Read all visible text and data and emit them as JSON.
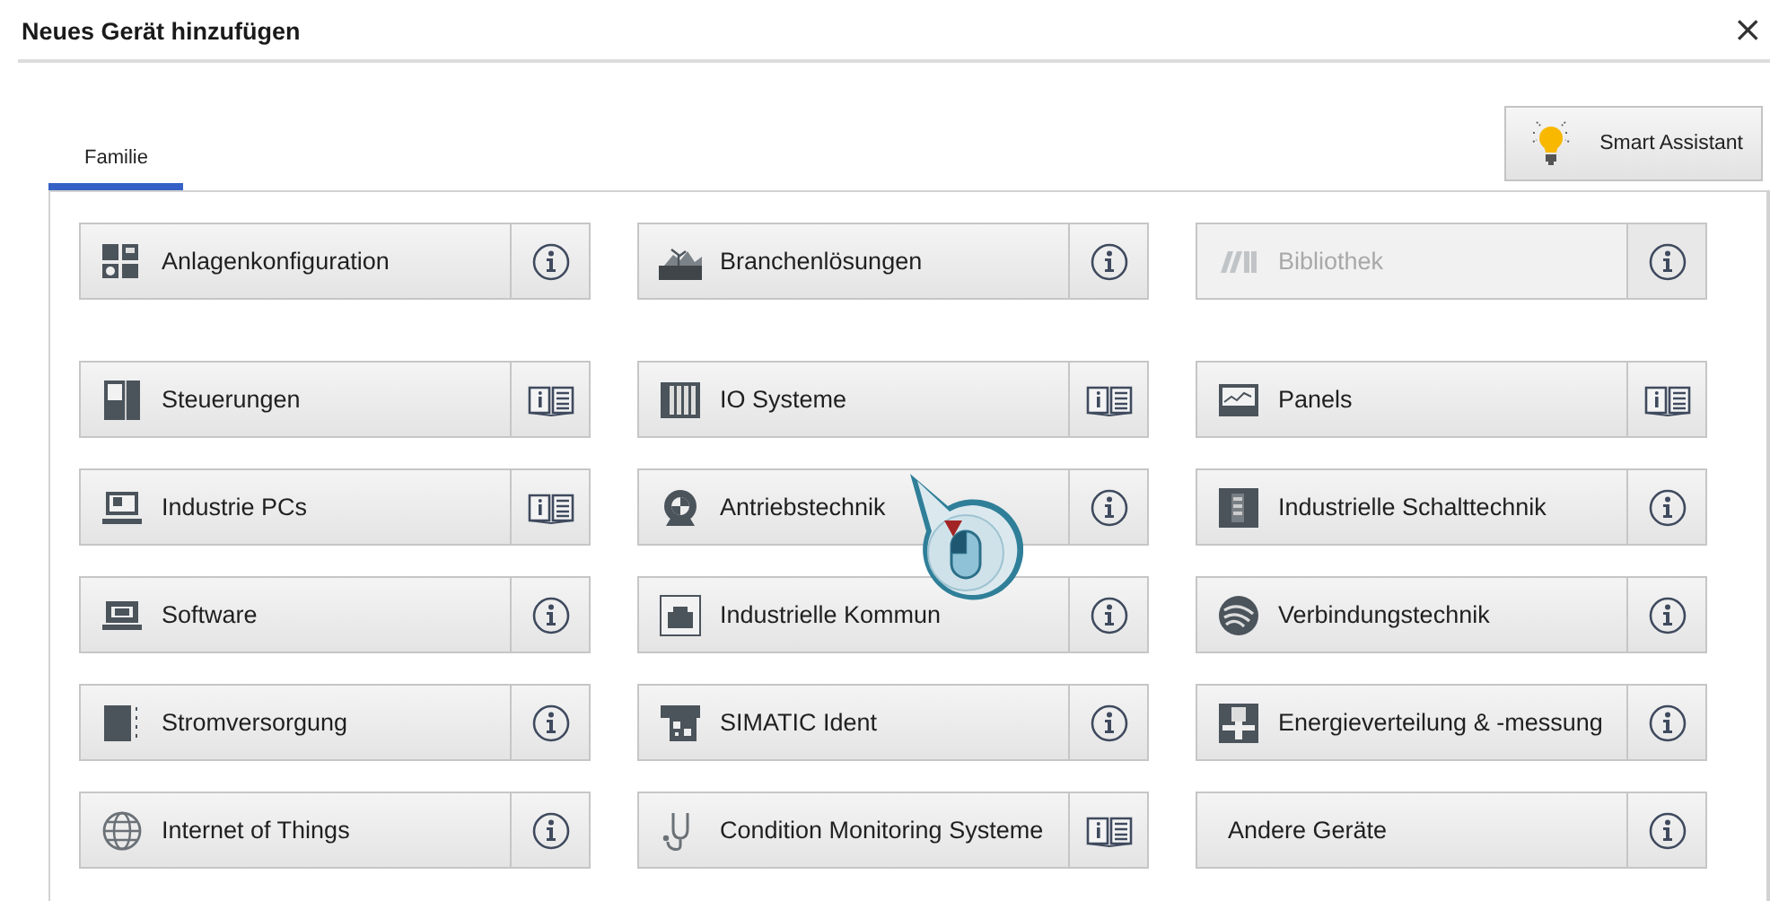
{
  "dialog": {
    "title": "Neues Gerät hinzufügen",
    "close": "×"
  },
  "tabs": [
    {
      "label": "Familie",
      "selected": true
    }
  ],
  "assistant_button": {
    "label": "Smart Assistant"
  },
  "groups": [
    [
      {
        "label": "Anlagenkonfiguration",
        "icon": true,
        "disabled": false,
        "kind": "info"
      },
      {
        "label": "Branchenlösungen",
        "icon": true,
        "disabled": false,
        "kind": "info"
      },
      {
        "label": "Bibliothek",
        "icon": true,
        "disabled": true,
        "kind": "info"
      }
    ],
    [
      {
        "label": "Steuerungen",
        "icon": true,
        "disabled": false,
        "kind": "manual"
      },
      {
        "label": "IO Systeme",
        "icon": true,
        "disabled": false,
        "kind": "manual"
      },
      {
        "label": "Panels",
        "icon": true,
        "disabled": false,
        "kind": "manual"
      },
      {
        "label": "Industrie PCs",
        "icon": true,
        "disabled": false,
        "kind": "manual"
      },
      {
        "label": "Antriebstechnik",
        "icon": true,
        "disabled": false,
        "kind": "info"
      },
      {
        "label": "Industrielle Schalttechnik",
        "icon": true,
        "disabled": false,
        "kind": "info"
      },
      {
        "label": "Software",
        "icon": true,
        "disabled": false,
        "kind": "info"
      },
      {
        "label": "Industrielle Kommun",
        "icon": true,
        "disabled": false,
        "kind": "info"
      },
      {
        "label": "Verbindungstechnik",
        "icon": true,
        "disabled": false,
        "kind": "info"
      },
      {
        "label": "Stromversorgung",
        "icon": true,
        "disabled": false,
        "kind": "info"
      },
      {
        "label": "SIMATIC Ident",
        "icon": true,
        "disabled": false,
        "kind": "info"
      },
      {
        "label": "Energieverteilung & -messung",
        "icon": true,
        "disabled": false,
        "kind": "info"
      },
      {
        "label": "Internet of Things",
        "icon": true,
        "disabled": false,
        "kind": "info"
      },
      {
        "label": "Condition Monitoring Systeme",
        "icon": true,
        "disabled": false,
        "kind": "manual"
      },
      {
        "label": "Andere Geräte",
        "icon": false,
        "disabled": false,
        "kind": "info"
      }
    ]
  ]
}
